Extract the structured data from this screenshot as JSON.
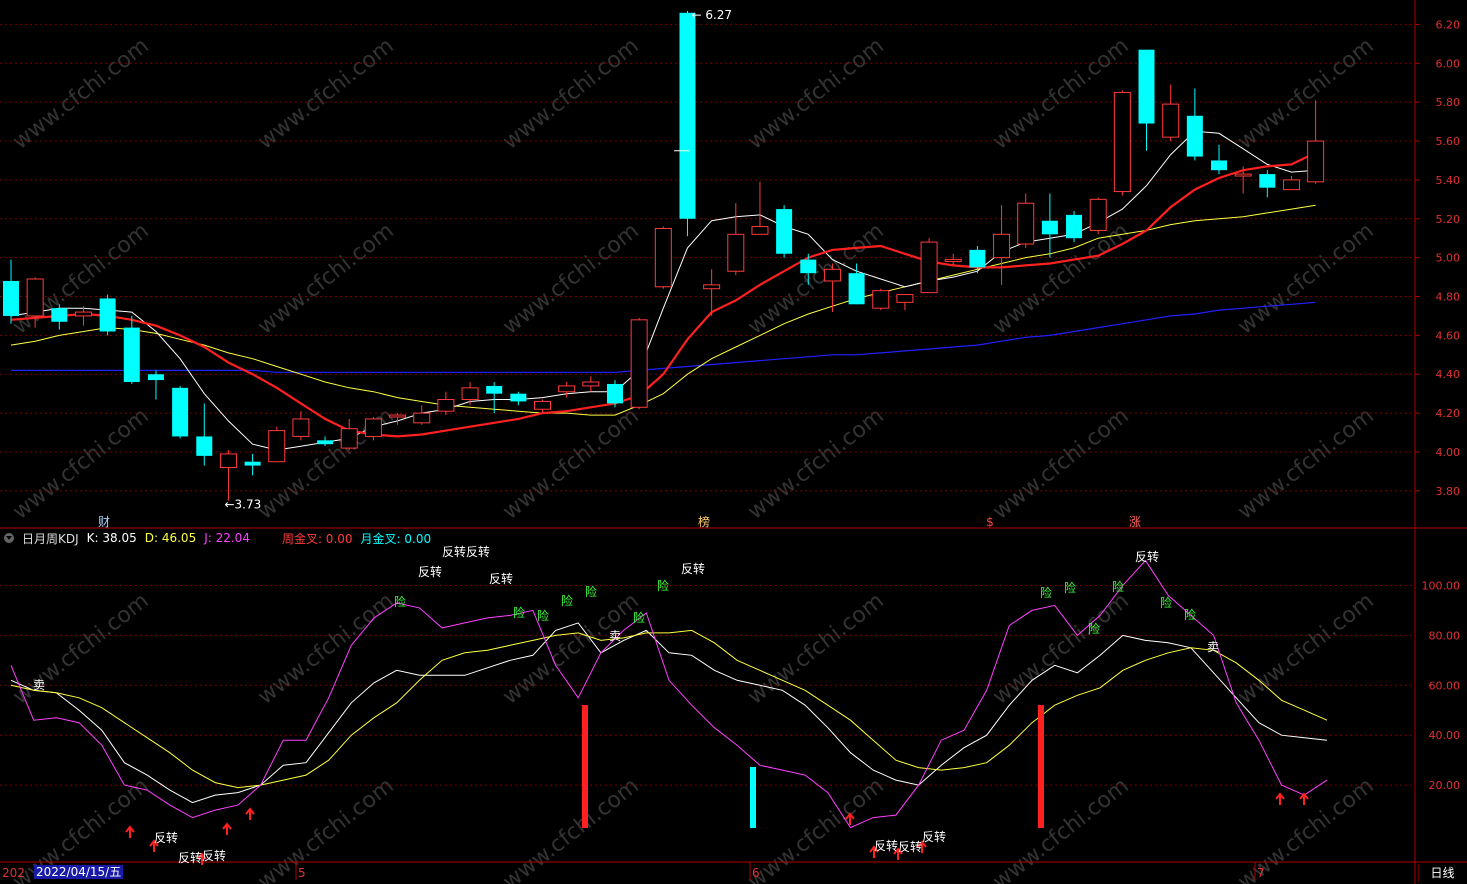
{
  "colors": {
    "up": "#ff3a3a",
    "down": "#00ffff",
    "grid": "#7a0000",
    "axis": "#b00000",
    "ma5": "#ffffff",
    "ma10": "#ff2020",
    "ma20": "#ffff40",
    "ma60": "#2020ff",
    "k": "#ffffff",
    "d": "#ffff40",
    "j": "#ff40ff"
  },
  "price_axis": {
    "ticks": [
      "6.20",
      "6.00",
      "5.80",
      "5.60",
      "5.40",
      "5.20",
      "5.00",
      "4.80",
      "4.60",
      "4.40",
      "4.20",
      "4.00",
      "3.80"
    ]
  },
  "ind_axis": {
    "ticks": [
      "100.00",
      "80.00",
      "60.00",
      "40.00",
      "20.00"
    ]
  },
  "time_axis": {
    "labels": [
      "202",
      "5",
      "6",
      "7"
    ]
  },
  "selected_date": "2022/04/15/五",
  "period_button": "日线",
  "indicator": {
    "name": "日月周KDJ",
    "k_label": "K: 38.05",
    "d_label": "D: 46.05",
    "j_label": "J: 22.04",
    "week_cross": "周金叉: 0.00",
    "month_cross": "月金叉: 0.00"
  },
  "price_markers": {
    "high": "6.27",
    "low": "3.73"
  },
  "event_markers": [
    "财",
    "榜",
    "$",
    "涨"
  ],
  "watermark": "www.cfchi.com",
  "chart_data": [
    {
      "type": "candlestick",
      "ylim": [
        3.65,
        6.3
      ],
      "candles": [
        [
          4.88,
          4.7,
          4.99,
          4.66
        ],
        [
          4.7,
          4.89,
          4.9,
          4.64
        ],
        [
          4.74,
          4.67,
          4.76,
          4.63
        ],
        [
          4.7,
          4.72,
          4.75,
          4.65
        ],
        [
          4.79,
          4.62,
          4.81,
          4.6
        ],
        [
          4.64,
          4.36,
          4.7,
          4.35
        ],
        [
          4.4,
          4.37,
          4.42,
          4.27
        ],
        [
          4.33,
          4.08,
          4.34,
          4.07
        ],
        [
          4.08,
          3.98,
          4.25,
          3.93
        ],
        [
          3.92,
          3.99,
          4.01,
          3.75
        ],
        [
          3.95,
          3.93,
          3.99,
          3.88
        ],
        [
          3.95,
          4.11,
          4.13,
          3.95
        ],
        [
          4.08,
          4.17,
          4.21,
          4.06
        ],
        [
          4.06,
          4.04,
          4.08,
          4.03
        ],
        [
          4.02,
          4.12,
          4.17,
          4.01
        ],
        [
          4.08,
          4.17,
          4.18,
          4.06
        ],
        [
          4.18,
          4.19,
          4.2,
          4.14
        ],
        [
          4.15,
          4.2,
          4.24,
          4.14
        ],
        [
          4.21,
          4.27,
          4.31,
          4.19
        ],
        [
          4.27,
          4.33,
          4.36,
          4.24
        ],
        [
          4.34,
          4.3,
          4.36,
          4.2
        ],
        [
          4.3,
          4.26,
          4.31,
          4.24
        ],
        [
          4.22,
          4.26,
          4.27,
          4.2
        ],
        [
          4.31,
          4.34,
          4.36,
          4.28
        ],
        [
          4.34,
          4.36,
          4.39,
          4.31
        ],
        [
          4.35,
          4.25,
          4.37,
          4.23
        ],
        [
          4.23,
          4.68,
          4.69,
          4.22
        ],
        [
          4.85,
          5.15,
          5.16,
          4.84
        ],
        [
          6.26,
          5.2,
          6.27,
          5.11
        ],
        [
          4.84,
          4.86,
          4.94,
          4.7
        ],
        [
          4.93,
          5.12,
          5.28,
          4.91
        ],
        [
          5.12,
          5.16,
          5.39,
          5.14
        ],
        [
          5.25,
          5.02,
          5.27,
          5.0
        ],
        [
          4.99,
          4.92,
          5.02,
          4.86
        ],
        [
          4.88,
          4.94,
          4.97,
          4.72
        ],
        [
          4.92,
          4.76,
          4.97,
          4.76
        ],
        [
          4.74,
          4.83,
          4.84,
          4.73
        ],
        [
          4.77,
          4.81,
          4.81,
          4.73
        ],
        [
          4.82,
          5.08,
          5.1,
          4.82
        ],
        [
          4.98,
          4.99,
          5.02,
          4.96
        ],
        [
          5.04,
          4.95,
          5.06,
          4.92
        ],
        [
          5.0,
          5.12,
          5.27,
          4.86
        ],
        [
          5.07,
          5.28,
          5.33,
          5.05
        ],
        [
          5.19,
          5.12,
          5.33,
          5.0
        ],
        [
          5.22,
          5.1,
          5.24,
          5.08
        ],
        [
          5.14,
          5.3,
          5.31,
          5.12
        ],
        [
          5.34,
          5.85,
          5.86,
          5.32
        ],
        [
          6.07,
          5.69,
          6.07,
          5.55
        ],
        [
          5.62,
          5.79,
          5.89,
          5.6
        ],
        [
          5.73,
          5.52,
          5.87,
          5.5
        ],
        [
          5.5,
          5.45,
          5.58,
          5.43
        ],
        [
          5.42,
          5.43,
          5.47,
          5.33
        ],
        [
          5.43,
          5.36,
          5.45,
          5.31
        ],
        [
          5.35,
          5.4,
          5.42,
          5.35
        ],
        [
          5.39,
          5.6,
          5.81,
          5.38
        ]
      ],
      "ma5": [
        4.7,
        4.72,
        4.74,
        4.74,
        4.73,
        4.72,
        4.62,
        4.48,
        4.3,
        4.16,
        4.04,
        4.01,
        4.03,
        4.05,
        4.07,
        4.13,
        4.16,
        4.2,
        4.22,
        4.26,
        4.27,
        4.27,
        4.28,
        4.3,
        4.31,
        4.31,
        4.42,
        4.74,
        5.05,
        5.19,
        5.21,
        5.22,
        5.16,
        5.12,
        4.99,
        4.93,
        4.89,
        4.85,
        4.88,
        4.9,
        4.93,
        5.03,
        5.08,
        5.1,
        5.12,
        5.18,
        5.25,
        5.37,
        5.53,
        5.65,
        5.64,
        5.56,
        5.48,
        5.44,
        5.45
      ],
      "ma10": [
        4.68,
        4.69,
        4.7,
        4.71,
        4.7,
        4.68,
        4.65,
        4.6,
        4.54,
        4.46,
        4.4,
        4.33,
        4.25,
        4.17,
        4.11,
        4.09,
        4.08,
        4.09,
        4.11,
        4.13,
        4.15,
        4.17,
        4.2,
        4.21,
        4.23,
        4.25,
        4.29,
        4.4,
        4.58,
        4.72,
        4.78,
        4.86,
        4.93,
        5.0,
        5.04,
        5.05,
        5.06,
        5.02,
        4.98,
        4.96,
        4.95,
        4.95,
        4.96,
        4.97,
        4.99,
        5.01,
        5.07,
        5.14,
        5.26,
        5.35,
        5.41,
        5.45,
        5.47,
        5.48,
        5.54
      ],
      "ma20": [
        4.55,
        4.57,
        4.6,
        4.62,
        4.64,
        4.63,
        4.61,
        4.58,
        4.55,
        4.51,
        4.48,
        4.44,
        4.4,
        4.36,
        4.33,
        4.31,
        4.28,
        4.26,
        4.24,
        4.23,
        4.22,
        4.21,
        4.2,
        4.2,
        4.19,
        4.19,
        4.24,
        4.3,
        4.4,
        4.48,
        4.54,
        4.6,
        4.66,
        4.71,
        4.75,
        4.79,
        4.82,
        4.85,
        4.88,
        4.91,
        4.94,
        4.97,
        5.0,
        5.02,
        5.05,
        5.1,
        5.12,
        5.14,
        5.17,
        5.19,
        5.2,
        5.21,
        5.23,
        5.25,
        5.27
      ],
      "ma60": [
        4.42,
        4.42,
        4.42,
        4.42,
        4.42,
        4.42,
        4.42,
        4.42,
        4.42,
        4.42,
        4.42,
        4.41,
        4.41,
        4.41,
        4.41,
        4.41,
        4.41,
        4.41,
        4.41,
        4.41,
        4.41,
        4.41,
        4.41,
        4.41,
        4.41,
        4.41,
        4.42,
        4.43,
        4.44,
        4.45,
        4.46,
        4.47,
        4.48,
        4.49,
        4.5,
        4.5,
        4.51,
        4.52,
        4.53,
        4.54,
        4.55,
        4.57,
        4.59,
        4.6,
        4.62,
        4.64,
        4.66,
        4.68,
        4.7,
        4.71,
        4.73,
        4.74,
        4.75,
        4.76,
        4.77
      ]
    },
    {
      "type": "line",
      "ylim": [
        -10,
        115
      ],
      "series": [
        {
          "name": "K",
          "values": [
            62,
            58,
            57,
            50,
            42,
            29,
            24,
            18,
            13,
            16,
            17,
            20,
            28,
            29,
            41,
            53,
            61,
            66,
            64,
            64,
            64,
            67,
            70,
            72,
            82,
            85,
            73,
            78,
            82,
            73,
            72,
            66,
            62,
            60,
            58,
            52,
            43,
            33,
            26,
            22,
            20,
            28,
            35,
            40,
            52,
            62,
            68,
            65,
            72,
            80,
            78,
            77,
            75,
            65,
            55,
            45,
            40,
            39,
            38
          ]
        },
        {
          "name": "D",
          "values": [
            60,
            58,
            57,
            55,
            51,
            45,
            39,
            33,
            26,
            21,
            19,
            20,
            22,
            24,
            30,
            40,
            47,
            53,
            62,
            70,
            73,
            74,
            76,
            78,
            80,
            81,
            78,
            79,
            81,
            81,
            82,
            77,
            70,
            66,
            62,
            58,
            52,
            46,
            38,
            30,
            27,
            26,
            27,
            29,
            36,
            45,
            52,
            56,
            59,
            66,
            70,
            73,
            75,
            74,
            69,
            62,
            54,
            50,
            46
          ]
        },
        {
          "name": "J",
          "values": [
            68,
            46,
            47,
            45,
            36,
            20,
            18,
            12,
            7,
            10,
            12,
            20,
            38,
            38,
            55,
            76,
            87,
            93,
            91,
            83,
            85,
            87,
            88,
            90,
            68,
            55,
            73,
            82,
            89,
            62,
            52,
            43,
            36,
            28,
            26,
            24,
            17,
            3,
            7,
            8,
            20,
            38,
            42,
            58,
            84,
            90,
            92,
            80,
            88,
            100,
            110,
            96,
            88,
            80,
            53,
            38,
            20,
            16,
            22
          ]
        }
      ]
    }
  ]
}
